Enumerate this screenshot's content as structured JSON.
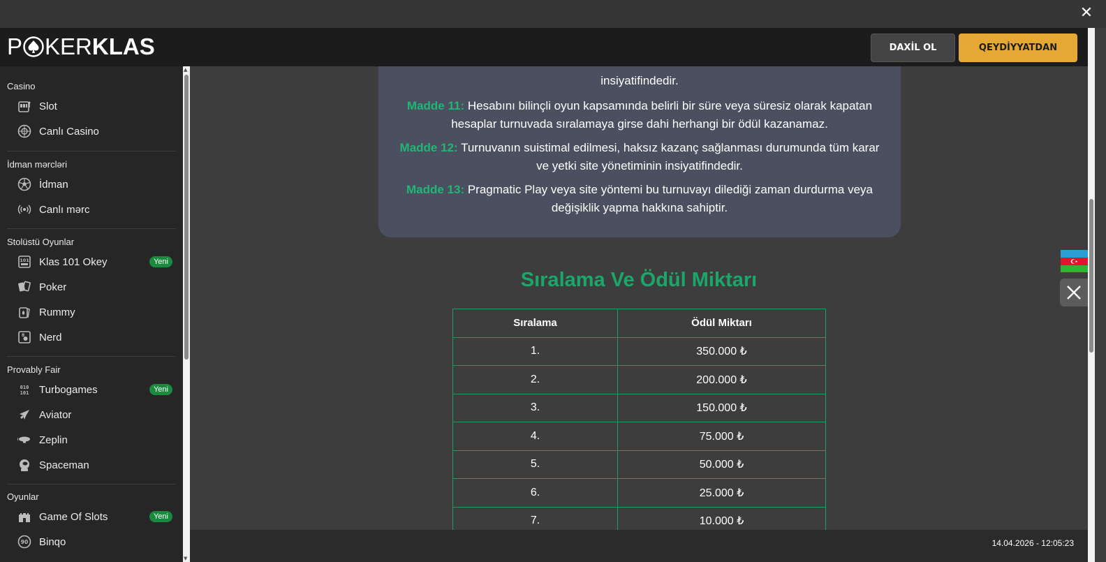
{
  "top_bar": {
    "close_label": "✕"
  },
  "header": {
    "logo_part1": "P",
    "logo_part2": "KER",
    "logo_part3": "KLAS",
    "login_label": "DAXİL OL",
    "register_label": "QEYDİYYATDAN"
  },
  "sidebar": {
    "sections": [
      {
        "title": "Casino",
        "items": [
          {
            "label": "Slot",
            "icon": "slot-machine-icon"
          },
          {
            "label": "Canlı Casino",
            "icon": "roulette-icon"
          }
        ]
      },
      {
        "title": "İdman mərcləri",
        "items": [
          {
            "label": "İdman",
            "icon": "soccer-ball-icon"
          },
          {
            "label": "Canlı mərc",
            "icon": "live-broadcast-icon"
          }
        ]
      },
      {
        "title": "Stolüstü Oyunlar",
        "items": [
          {
            "label": "Klas 101 Okey",
            "icon": "okey-tile-icon",
            "badge": "Yeni"
          },
          {
            "label": "Poker",
            "icon": "cards-icon"
          },
          {
            "label": "Rummy",
            "icon": "rummy-cards-icon"
          },
          {
            "label": "Nerd",
            "icon": "nerd-card-icon"
          }
        ]
      },
      {
        "title": "Provably Fair",
        "items": [
          {
            "label": "Turbogames",
            "icon": "turbogames-icon",
            "badge": "Yeni"
          },
          {
            "label": "Aviator",
            "icon": "airplane-icon"
          },
          {
            "label": "Zeplin",
            "icon": "zeppelin-icon"
          },
          {
            "label": "Spaceman",
            "icon": "astronaut-icon"
          }
        ]
      },
      {
        "title": "Oyunlar",
        "items": [
          {
            "label": "Game Of Slots",
            "icon": "castle-icon",
            "badge": "Yeni"
          },
          {
            "label": "Binqo",
            "icon": "bingo-ball-icon"
          }
        ]
      }
    ]
  },
  "rules": {
    "line0": "insiyatifindedir.",
    "items": [
      {
        "num": "Madde 11:",
        "text": " Hesabını bilinçli oyun kapsamında belirli bir süre veya süresiz olarak kapatan hesaplar turnuvada sıralamaya girse dahi herhangi bir ödül kazanamaz."
      },
      {
        "num": "Madde 12:",
        "text": " Turnuvanın suistimal edilmesi, haksız kazanç sağlanması durumunda tüm karar ve yetki site yönetiminin insiyatifindedir."
      },
      {
        "num": "Madde 13:",
        "text": " Pragmatic Play veya site yöntemi bu turnuvayı dilediği zaman durdurma veya değişiklik yapma hakkına sahiptir."
      }
    ]
  },
  "ranking": {
    "title": "Sıralama Ve Ödül Miktarı",
    "headers": [
      "Sıralama",
      "Ödül Miktarı"
    ],
    "rows": [
      [
        "1.",
        "350.000 ₺"
      ],
      [
        "2.",
        "200.000 ₺"
      ],
      [
        "3.",
        "150.000 ₺"
      ],
      [
        "4.",
        "75.000 ₺"
      ],
      [
        "5.",
        "50.000 ₺"
      ],
      [
        "6.",
        "25.000 ₺"
      ],
      [
        "7.",
        "10.000 ₺"
      ]
    ]
  },
  "footer": {
    "timestamp": "14.04.2026 - 12:05:23"
  },
  "colors": {
    "accent_green": "#22b573",
    "brand_yellow": "#e6a835",
    "badge_green": "#1a8a3f",
    "card_bg": "#4a5060"
  }
}
